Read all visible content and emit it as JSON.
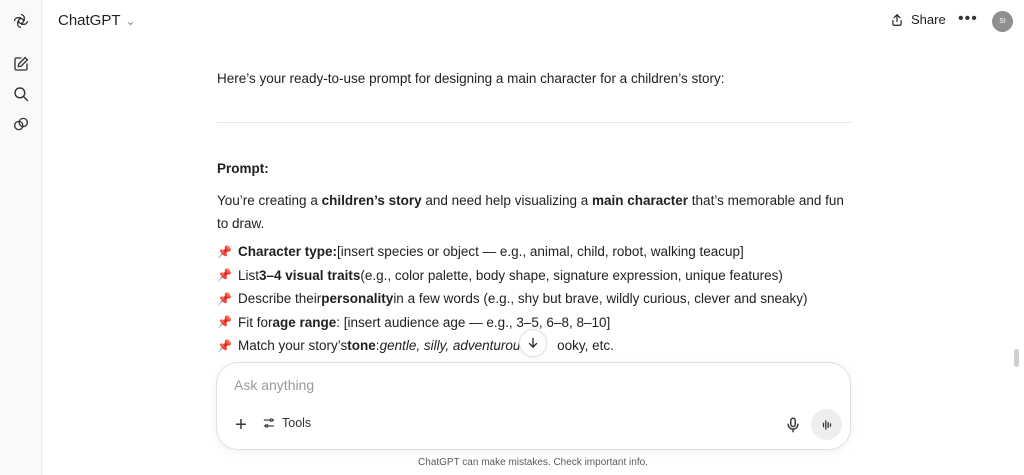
{
  "header": {
    "model_name": "ChatGPT",
    "share_label": "Share",
    "avatar_initials": "SI"
  },
  "rail": {
    "items": [
      {
        "icon": "chatgpt-logo-icon"
      },
      {
        "icon": "new-chat-icon"
      },
      {
        "icon": "search-icon"
      },
      {
        "icon": "library-icon"
      }
    ]
  },
  "message": {
    "intro": "Here’s your ready-to-use prompt for designing a main character for a children’s story:",
    "prompt_heading": "Prompt:",
    "para": {
      "t1": "You’re creating a ",
      "b1": "children’s story",
      "t2": " and need help visualizing a ",
      "b2": "main character",
      "t3": " that’s memorable and fun to draw."
    },
    "items": [
      {
        "pin": "📌",
        "bold": "Character type:",
        "rest": " [insert species or object — e.g., animal, child, robot, walking teacup]"
      },
      {
        "pin": "📌",
        "pre": "List ",
        "bold": "3–4 visual traits",
        "rest": " (e.g., color palette, body shape, signature expression, unique features)"
      },
      {
        "pin": "📌",
        "pre": "Describe their ",
        "bold": "personality",
        "rest": " in a few words (e.g., shy but brave, wildly curious, clever and sneaky)"
      },
      {
        "pin": "📌",
        "pre": "Fit for ",
        "bold": "age range",
        "rest": ": [insert audience age — e.g., 3–5, 6–8, 8–10]"
      },
      {
        "pin": "📌",
        "pre": "Match your story’s ",
        "bold": "tone",
        "rest": ": ",
        "italic": "gentle, silly, adventurous",
        "rest2": "ooky, etc."
      }
    ]
  },
  "composer": {
    "placeholder": "Ask anything",
    "tools_label": "Tools"
  },
  "footer": {
    "note": "ChatGPT can make mistakes. Check important info."
  },
  "colors": {
    "pin": "#d6363f",
    "rail_bg": "#f9f9f9"
  }
}
